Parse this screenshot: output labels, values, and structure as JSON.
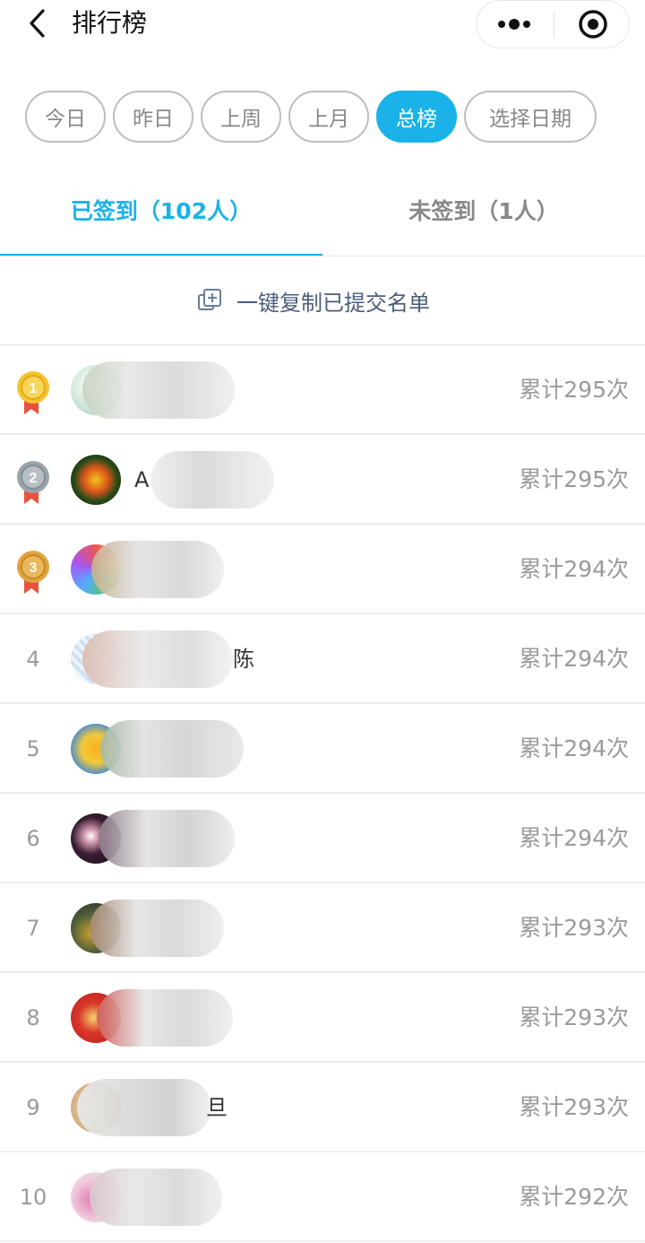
{
  "header": {
    "title": "排行榜",
    "back_icon": "chevron-left-icon",
    "more_icon": "more-dots-icon",
    "close_icon": "target-circle-icon"
  },
  "filters": [
    {
      "label": "今日",
      "active": false
    },
    {
      "label": "昨日",
      "active": false
    },
    {
      "label": "上周",
      "active": false
    },
    {
      "label": "上月",
      "active": false
    },
    {
      "label": "总榜",
      "active": true
    },
    {
      "label": "选择日期",
      "active": false
    }
  ],
  "tabs": [
    {
      "label": "已签到（102人）",
      "active": true
    },
    {
      "label": "未签到（1人）",
      "active": false
    }
  ],
  "copy": {
    "label": "一键复制已提交名单",
    "icon": "copy-add-icon"
  },
  "accent": "#1ab2e8",
  "list": [
    {
      "rank": "1",
      "name_visible": "",
      "count": "累计295次"
    },
    {
      "rank": "2",
      "name_visible": "A",
      "count": "累计295次"
    },
    {
      "rank": "3",
      "name_visible": "",
      "count": "累计294次"
    },
    {
      "rank": "4",
      "name_visible": "陈",
      "count": "累计294次"
    },
    {
      "rank": "5",
      "name_visible": "",
      "count": "累计294次"
    },
    {
      "rank": "6",
      "name_visible": "",
      "count": "累计294次"
    },
    {
      "rank": "7",
      "name_visible": "",
      "count": "累计293次"
    },
    {
      "rank": "8",
      "name_visible": "",
      "count": "累计293次"
    },
    {
      "rank": "9",
      "name_visible": "旦",
      "count": "累计293次"
    },
    {
      "rank": "10",
      "name_visible": "",
      "count": "累计292次"
    }
  ]
}
